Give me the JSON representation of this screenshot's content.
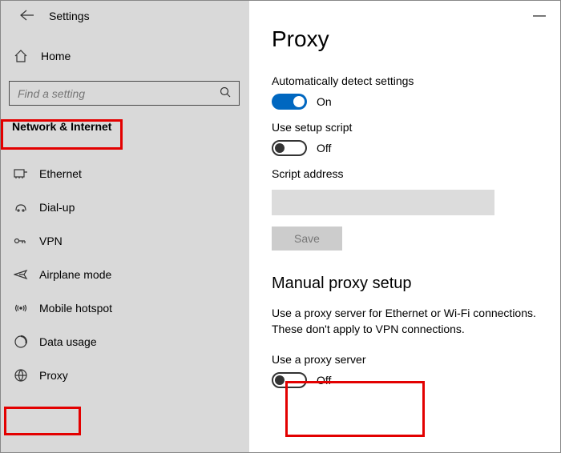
{
  "window": {
    "title": "Settings",
    "minimize": "—"
  },
  "sidebar": {
    "home": "Home",
    "search_placeholder": "Find a setting",
    "section": "Network & Internet",
    "items": [
      {
        "icon": "ethernet-icon",
        "label": "Ethernet"
      },
      {
        "icon": "dialup-icon",
        "label": "Dial-up"
      },
      {
        "icon": "vpn-icon",
        "label": "VPN"
      },
      {
        "icon": "airplane-icon",
        "label": "Airplane mode"
      },
      {
        "icon": "hotspot-icon",
        "label": "Mobile hotspot"
      },
      {
        "icon": "data-usage-icon",
        "label": "Data usage"
      },
      {
        "icon": "proxy-icon",
        "label": "Proxy"
      }
    ]
  },
  "proxy": {
    "title": "Proxy",
    "auto_label": "Automatically detect settings",
    "auto_state": "On",
    "script_label": "Use setup script",
    "script_state": "Off",
    "script_addr_label": "Script address",
    "script_addr_value": "",
    "save": "Save",
    "manual_heading": "Manual proxy setup",
    "manual_desc": "Use a proxy server for Ethernet or Wi-Fi connections. These don't apply to VPN connections.",
    "use_proxy_label": "Use a proxy server",
    "use_proxy_state": "Off"
  }
}
